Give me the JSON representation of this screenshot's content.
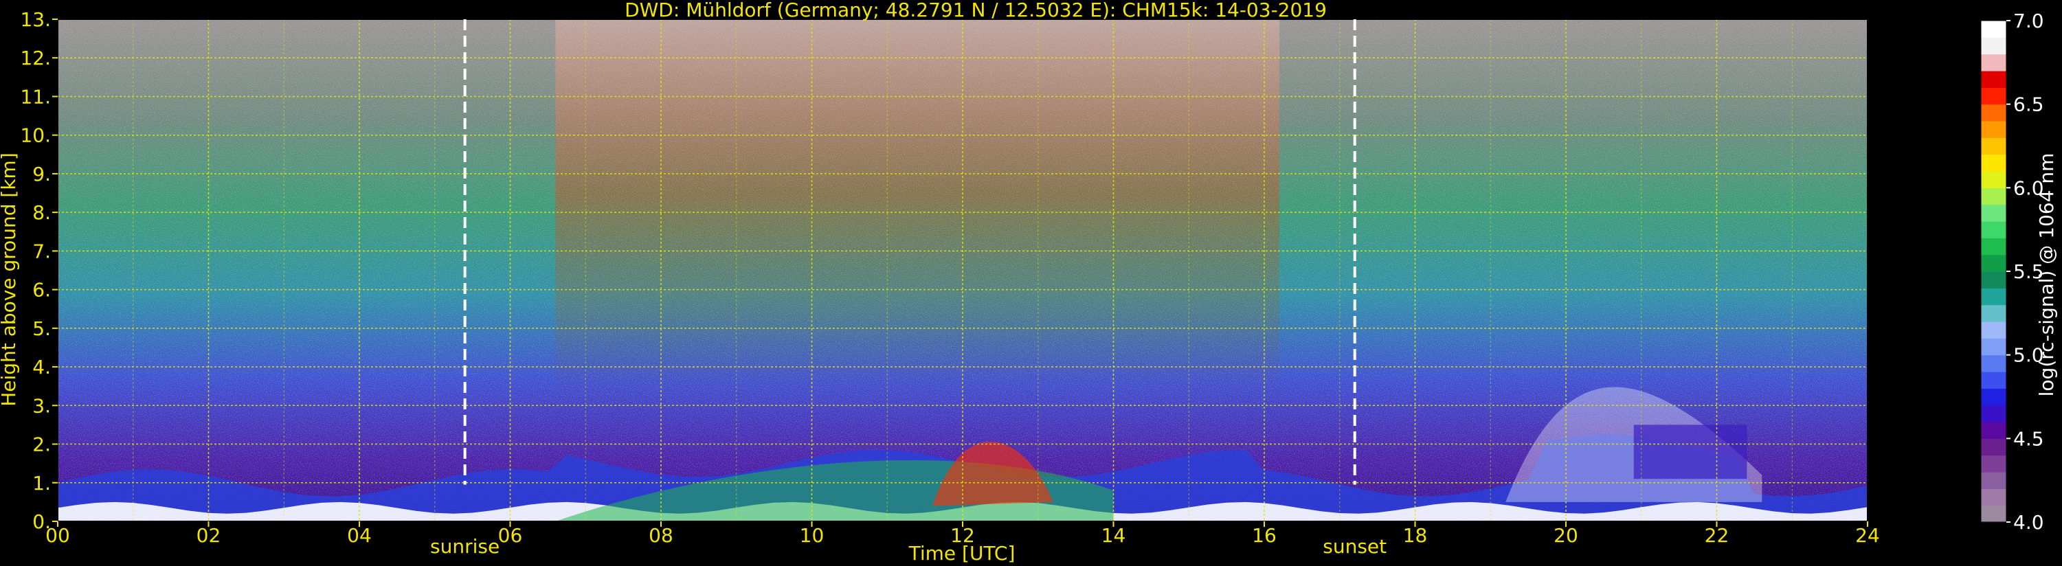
{
  "chart_data": {
    "type": "heatmap",
    "title": "DWD: Mühldorf (Germany; 48.2791 N / 12.5032 E):    CHM15k: 14-03-2019",
    "xlabel": "Time [UTC]",
    "ylabel": "Height above ground [km]",
    "xlim": [
      0,
      24
    ],
    "ylim": [
      0,
      13
    ],
    "x_ticks": [
      {
        "v": 0,
        "label": "00"
      },
      {
        "v": 2,
        "label": "02"
      },
      {
        "v": 4,
        "label": "04"
      },
      {
        "v": 6,
        "label": "06"
      },
      {
        "v": 8,
        "label": "08"
      },
      {
        "v": 10,
        "label": "10"
      },
      {
        "v": 12,
        "label": "12"
      },
      {
        "v": 14,
        "label": "14"
      },
      {
        "v": 16,
        "label": "16"
      },
      {
        "v": 18,
        "label": "18"
      },
      {
        "v": 20,
        "label": "20"
      },
      {
        "v": 22,
        "label": "22"
      },
      {
        "v": 24,
        "label": "24"
      }
    ],
    "y_ticks": [
      {
        "v": 0,
        "label": "0."
      },
      {
        "v": 1,
        "label": "1."
      },
      {
        "v": 2,
        "label": "2."
      },
      {
        "v": 3,
        "label": "3."
      },
      {
        "v": 4,
        "label": "4."
      },
      {
        "v": 5,
        "label": "5."
      },
      {
        "v": 6,
        "label": "6."
      },
      {
        "v": 7,
        "label": "7."
      },
      {
        "v": 8,
        "label": "8."
      },
      {
        "v": 9,
        "label": "9."
      },
      {
        "v": 10,
        "label": "10."
      },
      {
        "v": 11,
        "label": "11."
      },
      {
        "v": 12,
        "label": "12."
      },
      {
        "v": 13,
        "label": "13."
      }
    ],
    "grid": true,
    "colorbar": {
      "label": "log(rc-signal) @ 1064 nm",
      "range": [
        4.0,
        7.0
      ],
      "ticks": [
        {
          "v": 4.0,
          "label": "4.0"
        },
        {
          "v": 4.5,
          "label": "4.5"
        },
        {
          "v": 5.0,
          "label": "5.0"
        },
        {
          "v": 5.5,
          "label": "5.5"
        },
        {
          "v": 6.0,
          "label": "6.0"
        },
        {
          "v": 6.5,
          "label": "6.5"
        },
        {
          "v": 7.0,
          "label": "7.0"
        }
      ],
      "colors": [
        "#9c8aa0",
        "#a07aa6",
        "#8a5fa0",
        "#7d3f98",
        "#6a1f8e",
        "#5a0aa0",
        "#3a10c8",
        "#2020e0",
        "#3c50f0",
        "#5a7af2",
        "#7f9ef5",
        "#9fb8f7",
        "#63c0c8",
        "#1fa49a",
        "#128a5c",
        "#109e48",
        "#1ebe4e",
        "#3ed86a",
        "#6ee87e",
        "#a8f050",
        "#e0f21a",
        "#ffe600",
        "#ffc400",
        "#ff9a00",
        "#ff6a00",
        "#ff2000",
        "#e00000",
        "#f2b8bc",
        "#f2f2f2",
        "#ffffff"
      ]
    },
    "events": [
      {
        "name": "sunrise",
        "time": 5.4
      },
      {
        "name": "sunset",
        "time": 17.2
      }
    ],
    "colors": {
      "text": "#f2e600",
      "grid": "#e6e600",
      "event_line": "#ffffff",
      "background": "#000000"
    }
  }
}
